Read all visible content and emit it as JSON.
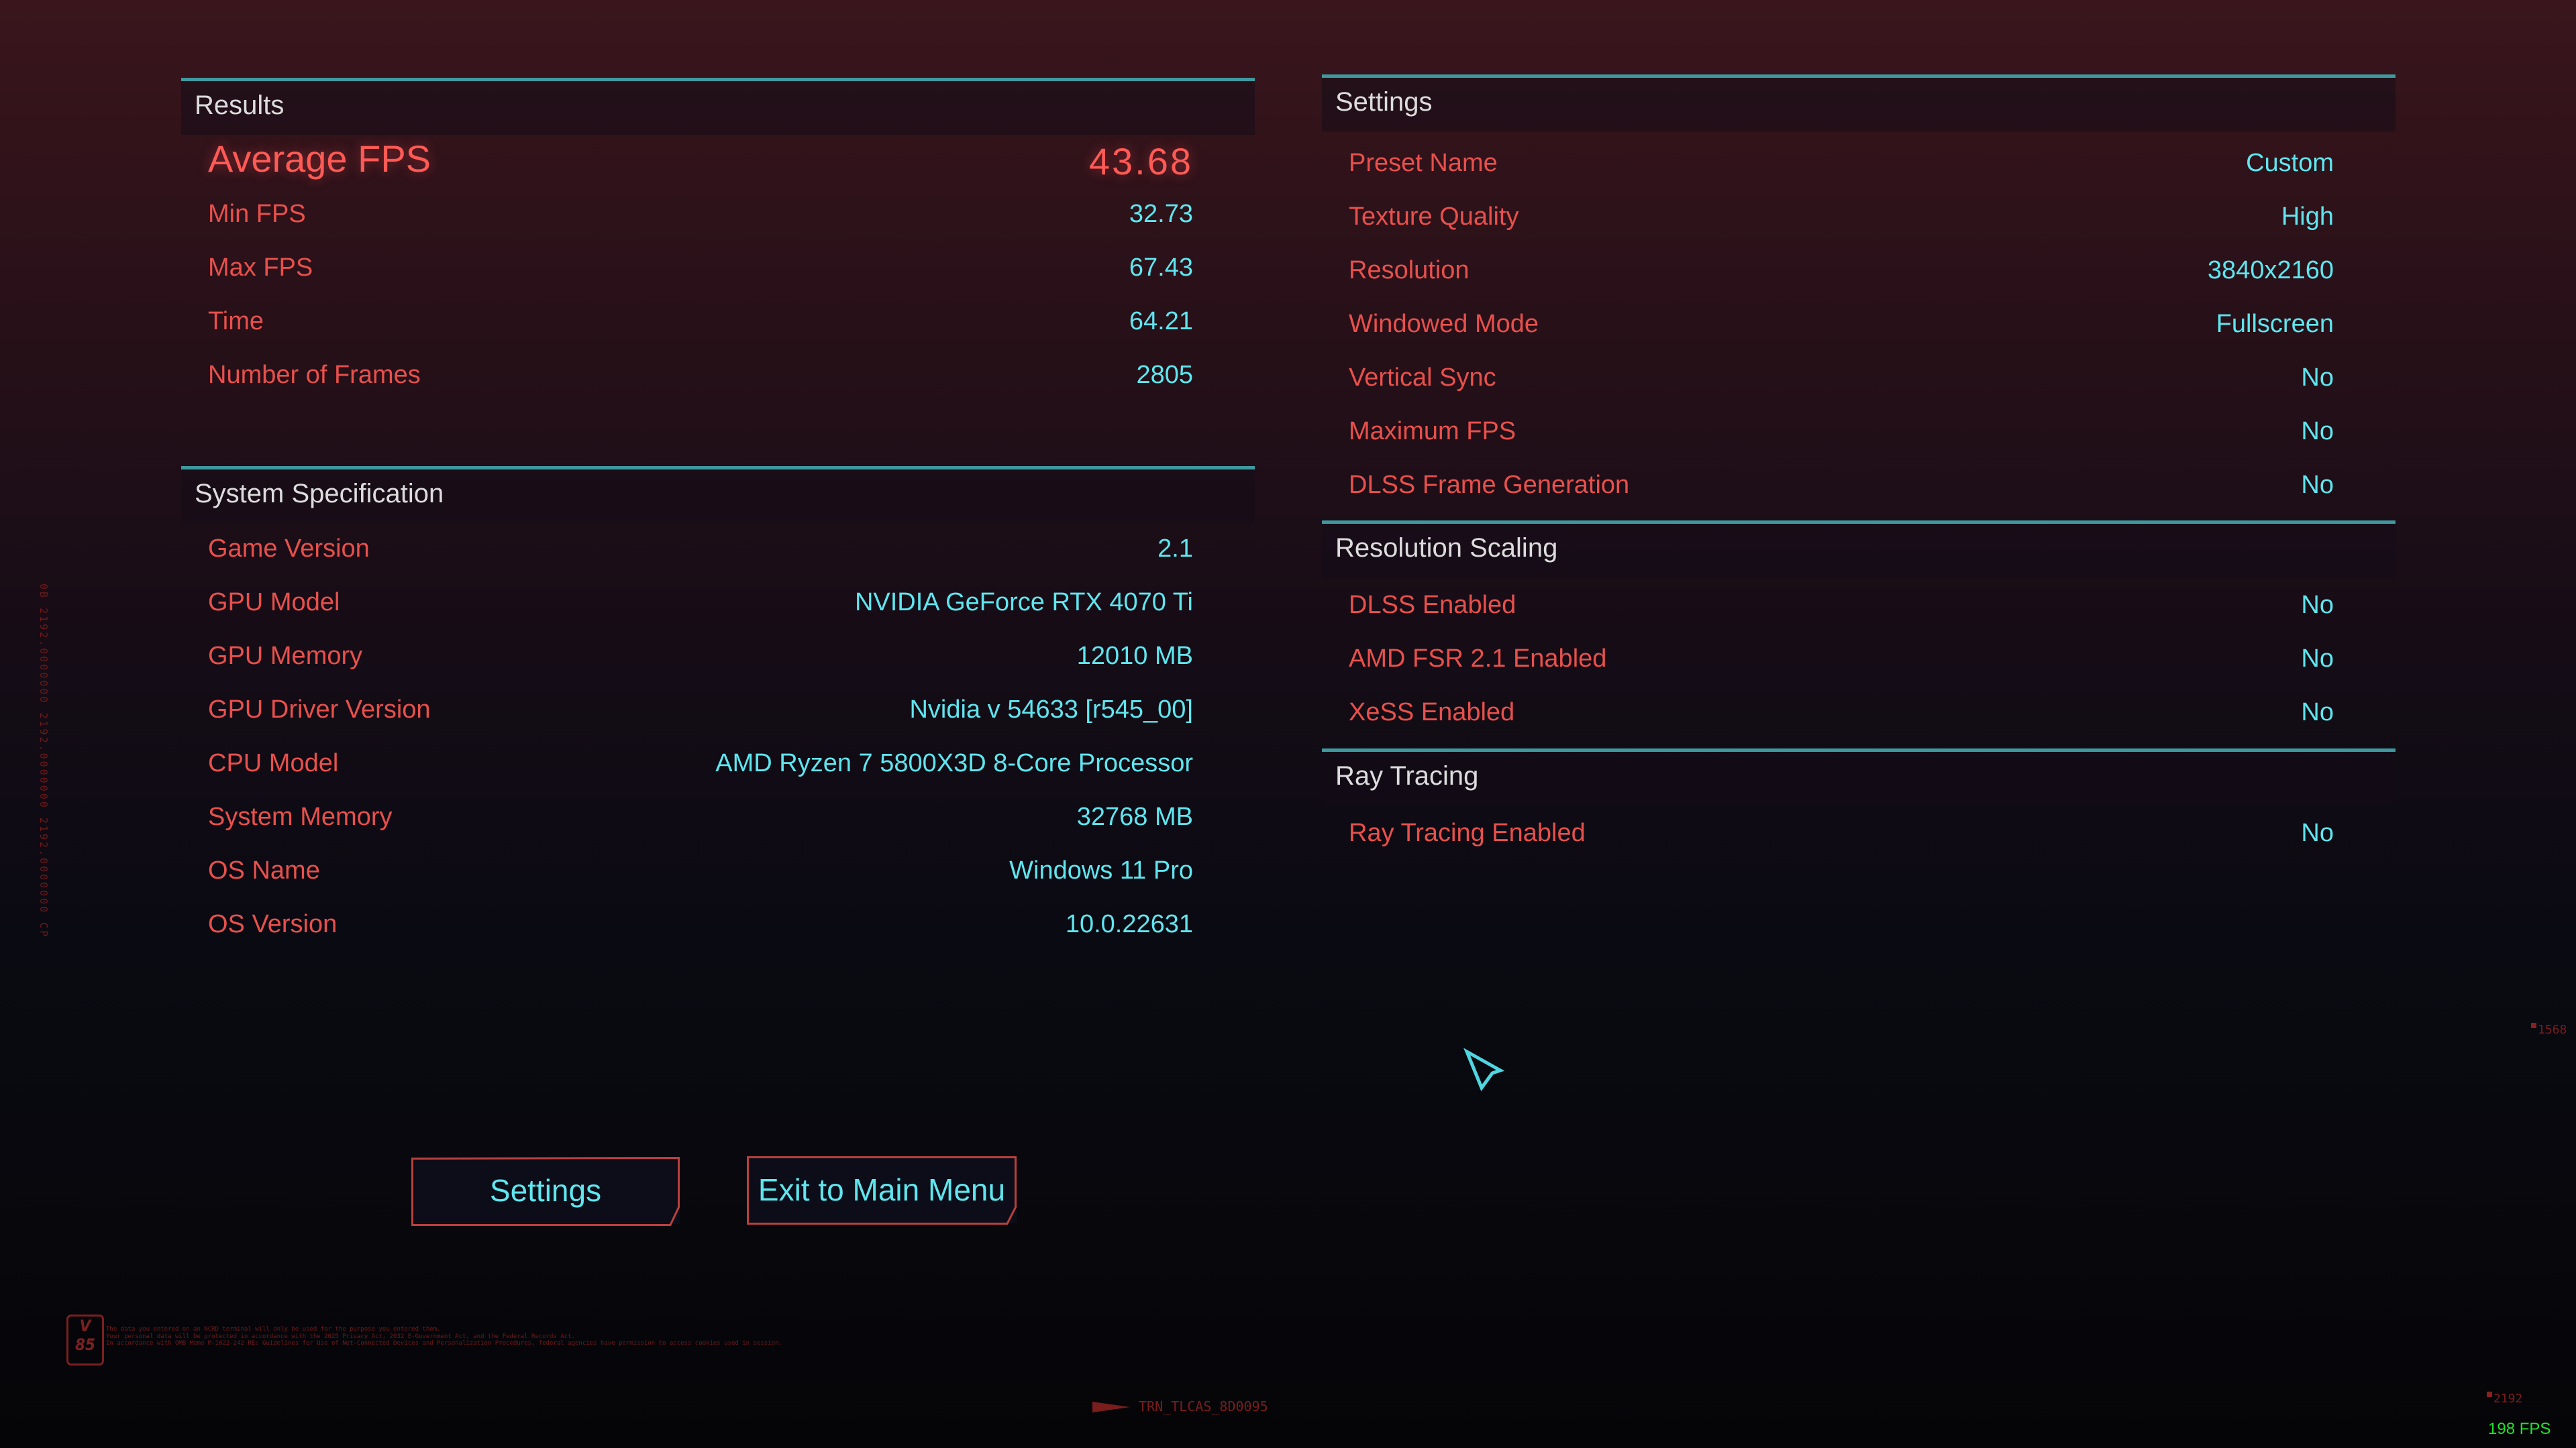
{
  "results": {
    "title": "Results",
    "average_fps": {
      "label": "Average FPS",
      "value": "43.68"
    },
    "rows": [
      {
        "label": "Min FPS",
        "value": "32.73"
      },
      {
        "label": "Max FPS",
        "value": "67.43"
      },
      {
        "label": "Time",
        "value": "64.21"
      },
      {
        "label": "Number of Frames",
        "value": "2805"
      }
    ]
  },
  "system_specification": {
    "title": "System Specification",
    "rows": [
      {
        "label": "Game Version",
        "value": "2.1"
      },
      {
        "label": "GPU Model",
        "value": "NVIDIA GeForce RTX 4070 Ti"
      },
      {
        "label": "GPU Memory",
        "value": "12010 MB"
      },
      {
        "label": "GPU Driver Version",
        "value": "Nvidia v 54633 [r545_00]"
      },
      {
        "label": "CPU Model",
        "value": "AMD Ryzen 7 5800X3D 8-Core Processor"
      },
      {
        "label": "System Memory",
        "value": "32768 MB"
      },
      {
        "label": "OS Name",
        "value": "Windows 11 Pro"
      },
      {
        "label": "OS Version",
        "value": "10.0.22631"
      }
    ]
  },
  "settings": {
    "title": "Settings",
    "rows": [
      {
        "label": "Preset Name",
        "value": "Custom"
      },
      {
        "label": "Texture Quality",
        "value": "High"
      },
      {
        "label": "Resolution",
        "value": "3840x2160"
      },
      {
        "label": "Windowed Mode",
        "value": "Fullscreen"
      },
      {
        "label": "Vertical Sync",
        "value": "No"
      },
      {
        "label": "Maximum FPS",
        "value": "No"
      },
      {
        "label": "DLSS Frame Generation",
        "value": "No"
      }
    ]
  },
  "resolution_scaling": {
    "title": "Resolution Scaling",
    "rows": [
      {
        "label": "DLSS Enabled",
        "value": "No"
      },
      {
        "label": "AMD FSR 2.1 Enabled",
        "value": "No"
      },
      {
        "label": "XeSS Enabled",
        "value": "No"
      }
    ]
  },
  "ray_tracing": {
    "title": "Ray Tracing",
    "rows": [
      {
        "label": "Ray Tracing Enabled",
        "value": "No"
      }
    ]
  },
  "buttons": {
    "settings": "Settings",
    "exit": "Exit to Main Menu"
  },
  "footer": {
    "logo_top": "V",
    "logo_bottom": "85",
    "legal_lines": [
      "The data you entered on an NCRD terminal will only be used for the purpose you entered them.",
      "Your personal data will be protected in accordance with the 2025 Privacy Act, 2032 E-Government Act, and the Federal Records Act.",
      "In accordance with OMB Memo M-1022-242 RE: Guidelines for Use of Net-Connected Devices and Personalization Procedures, federal agencies have permission to access cookies used in session."
    ],
    "build_id": "TRN_TLCAS_8D0095",
    "vertical_debug": "0B 2192.0000000 2192.0000000 2192.0000000 CP",
    "corner_num_right": "1568",
    "corner_num_bottom": "2192",
    "fps_counter": "198 FPS"
  },
  "colors": {
    "label": "#e8504c",
    "value": "#5fe6ef",
    "accent_line": "#3f9aa0",
    "highlight": "#ff5a55",
    "fps_counter": "#22e22a"
  }
}
